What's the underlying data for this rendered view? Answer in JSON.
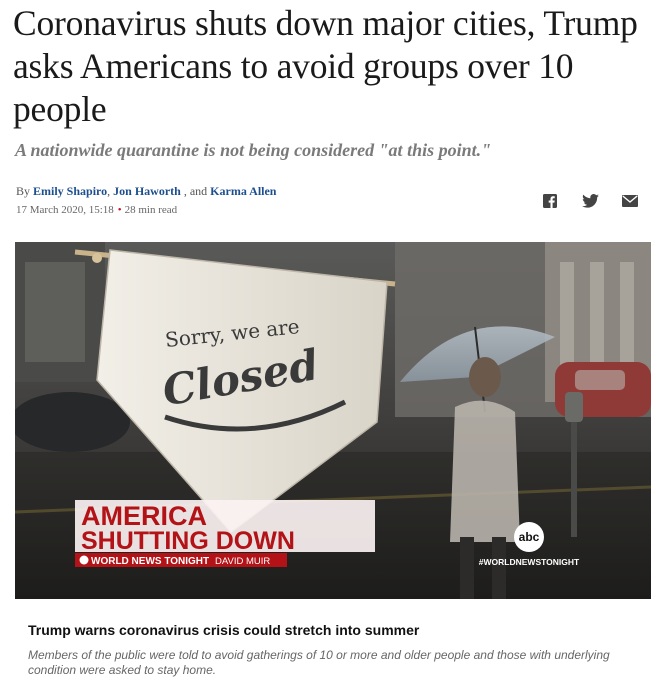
{
  "article": {
    "headline": "Coronavirus shuts down major cities, Trump asks Americans to avoid groups over 10 people",
    "subheadline": "A nationwide quarantine is not being considered \"at this point.\"",
    "byline": {
      "prefix": "By",
      "authors": [
        "Emily Shapiro",
        "Jon Haworth",
        "Karma Allen"
      ],
      "separator": ",",
      "conjunction": ", and"
    },
    "date": "17 March 2020, 15:18",
    "read_time": "28 min read",
    "share_icons": [
      "facebook-icon",
      "twitter-icon",
      "email-icon"
    ]
  },
  "video": {
    "sign_line1": "Sorry, we are",
    "sign_line2": "Closed",
    "banner_line1": "AMERICA",
    "banner_line2": "SHUTTING DOWN",
    "banner_sub": "WORLD NEWS TONIGHT",
    "banner_sub2": "DAVID MUIR",
    "network": "abc",
    "hashtag": "#WORLDNEWSTONIGHT"
  },
  "caption": {
    "title": "Trump warns coronavirus crisis could stretch into summer",
    "text": "Members of the public were told to avoid gatherings of 10 or more and older people and those with underlying condition were asked to stay home."
  },
  "colors": {
    "link": "#1d4f8f",
    "accent": "#c7102e",
    "banner_red": "#b31217"
  }
}
